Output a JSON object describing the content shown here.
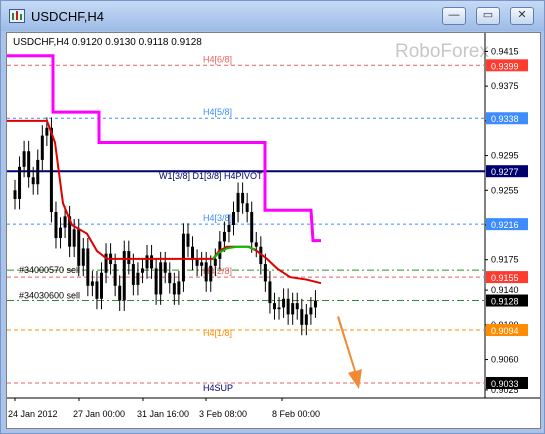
{
  "window": {
    "title": "USDCHF,H4",
    "buttons": {
      "minimize": "—",
      "restore": "▭",
      "close": "✕"
    }
  },
  "chart_header": "USDCHF,H4  0.9120 0.9130 0.9118 0.9128",
  "watermark": "RoboForex",
  "level_labels": {
    "h4_6_8": "H4[6/8]",
    "h4_5_8": "H4[5/8]",
    "pivot": "W1[3/8] D1[3/8] H4PIVOT",
    "h4_3_8": "H4[3/8]",
    "h4_2_8": "H4[2/8]",
    "h4_1_8": "H4[1/8]",
    "h4sup": "H4SUP",
    "order_1": "#34000570 sell",
    "order_2": "#34030600 sell"
  },
  "colors": {
    "bg": "#ffffff",
    "candles": "#000000",
    "magenta": "#ff00ff",
    "red_ma": "#e00000",
    "green_ma": "#00c000",
    "navy": "#00006e",
    "blue_dash": "#3c8cff",
    "red_dash": "#e86060",
    "orange": "#ff8c00",
    "green_dash": "#2f8f2f",
    "arrow": "#f08a35",
    "price_box": "#ff3b2f",
    "current_box": "#000000"
  },
  "chart_data": {
    "type": "candlestick",
    "symbol": "USDCHF",
    "timeframe": "H4",
    "ohlc_header": [
      0.912,
      0.913,
      0.9118,
      0.9128
    ],
    "y_range": [
      0.9018,
      0.9427
    ],
    "y_ticks": [
      "0.9415",
      "0.9375",
      "0.9335",
      "0.9295",
      "0.9255",
      "0.9215",
      "0.9175",
      "0.9140",
      "0.9100",
      "0.9060",
      "0.9025"
    ],
    "x_ticks": [
      "24 Jan 2012",
      "27 Jan 00:00",
      "31 Jan 16:00",
      "3 Feb 08:00",
      "8 Feb 00:00"
    ],
    "levels": [
      {
        "name": "H4[6/8]",
        "value": 0.9399,
        "badge": "0.9399",
        "badge_color": "#ff3b2f",
        "style": "red-dash"
      },
      {
        "name": "H4[5/8]",
        "value": 0.9338,
        "badge": "0.9338",
        "badge_color": "#3c8cff",
        "style": "blue-dash"
      },
      {
        "name": "W1[3/8] D1[3/8] H4PIVOT",
        "value": 0.9277,
        "badge": "0.9277",
        "badge_color": "#00006e",
        "style": "navy-solid"
      },
      {
        "name": "H4[3/8]",
        "value": 0.9216,
        "badge": "0.9216",
        "badge_color": "#3c8cff",
        "style": "blue-dash"
      },
      {
        "name": "#34000570 sell",
        "value": 0.9163,
        "badge": "",
        "badge_color": "",
        "style": "green-dashdot"
      },
      {
        "name": "H4[2/8]",
        "value": 0.9155,
        "badge": "0.9155",
        "badge_color": "#ff3b2f",
        "style": "red-dash"
      },
      {
        "name": "#34030600 sell",
        "value": 0.9128,
        "badge": "0.9128",
        "badge_color": "#000000",
        "style": "green-dashdot"
      },
      {
        "name": "H4[1/8]",
        "value": 0.9094,
        "badge": "0.9094",
        "badge_color": "#ff8c00",
        "style": "orange-dash"
      },
      {
        "name": "H4SUP",
        "value": 0.9033,
        "badge": "0.9033",
        "badge_color": "#000000",
        "style": "red-dash"
      }
    ],
    "candles_close": [
      0.9245,
      0.9282,
      0.93,
      0.927,
      0.9262,
      0.929,
      0.9318,
      0.9327,
      0.923,
      0.92,
      0.9212,
      0.9225,
      0.919,
      0.921,
      0.9168,
      0.9188,
      0.9145,
      0.915,
      0.913,
      0.916,
      0.9182,
      0.917,
      0.9145,
      0.9128,
      0.9185,
      0.917,
      0.9146,
      0.916,
      0.9165,
      0.918,
      0.9165,
      0.9135,
      0.9172,
      0.916,
      0.9148,
      0.9135,
      0.915,
      0.9205,
      0.919,
      0.9175,
      0.9168,
      0.9172,
      0.915,
      0.9168,
      0.9176,
      0.9196,
      0.9207,
      0.9215,
      0.923,
      0.9252,
      0.924,
      0.923,
      0.9195,
      0.919,
      0.917,
      0.915,
      0.9125,
      0.9118,
      0.912,
      0.913,
      0.9112,
      0.9125,
      0.9118,
      0.91,
      0.9112,
      0.912,
      0.9128
    ]
  }
}
